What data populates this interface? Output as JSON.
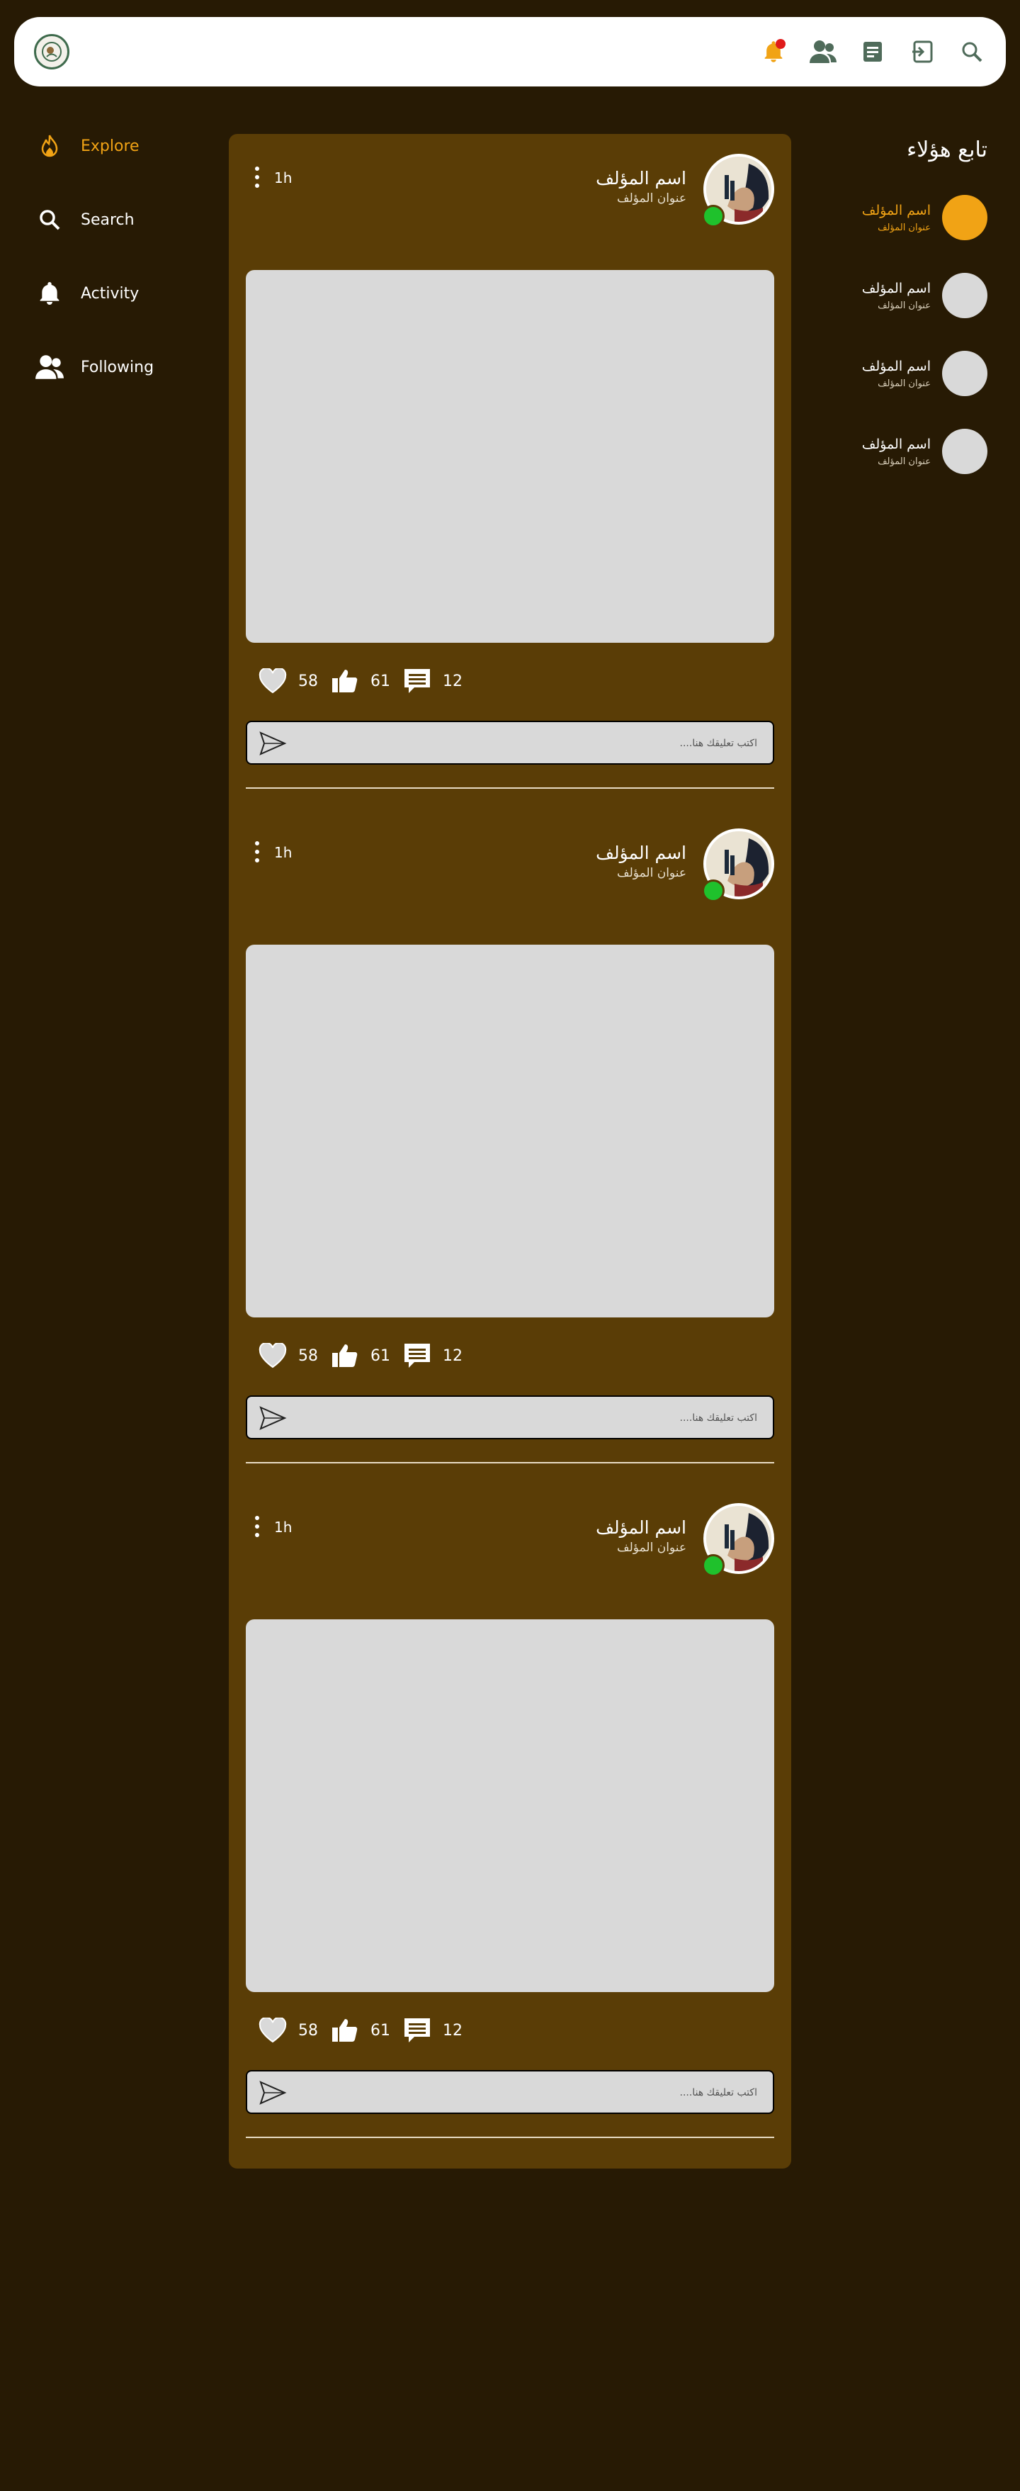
{
  "colors": {
    "background": "#271a04",
    "panel": "#5a3d06",
    "accent": "#f1a315",
    "online": "#1fc12c"
  },
  "header": {
    "logo_icon": "app-logo-icon",
    "icons": [
      "notification-bell-icon",
      "people-icon",
      "document-icon",
      "logout-icon",
      "search-icon"
    ]
  },
  "nav": {
    "items": [
      {
        "label": "Explore",
        "icon": "fire-icon",
        "active": true
      },
      {
        "label": "Search",
        "icon": "search-icon"
      },
      {
        "label": "Activity",
        "icon": "bell-icon"
      },
      {
        "label": "Following",
        "icon": "people-icon"
      }
    ]
  },
  "posts": [
    {
      "time": "1h",
      "author_name": "اسم المؤلف",
      "author_title": "عنوان المؤلف",
      "likes": "58",
      "thumbs": "61",
      "comments": "12",
      "comment_placeholder": "اكتب تعليقك هنا...."
    },
    {
      "time": "1h",
      "author_name": "اسم المؤلف",
      "author_title": "عنوان المؤلف",
      "likes": "58",
      "thumbs": "61",
      "comments": "12",
      "comment_placeholder": "اكتب تعليقك هنا...."
    },
    {
      "time": "1h",
      "author_name": "اسم المؤلف",
      "author_title": "عنوان المؤلف",
      "likes": "58",
      "thumbs": "61",
      "comments": "12",
      "comment_placeholder": "اكتب تعليقك هنا...."
    }
  ],
  "suggestions": {
    "title": "تابع هؤلاء",
    "items": [
      {
        "name": "اسم المؤلف",
        "sub": "عنوان المؤلف",
        "active": true
      },
      {
        "name": "اسم المؤلف",
        "sub": "عنوان المؤلف"
      },
      {
        "name": "اسم المؤلف",
        "sub": "عنوان المؤلف"
      },
      {
        "name": "اسم المؤلف",
        "sub": "عنوان المؤلف"
      }
    ]
  }
}
